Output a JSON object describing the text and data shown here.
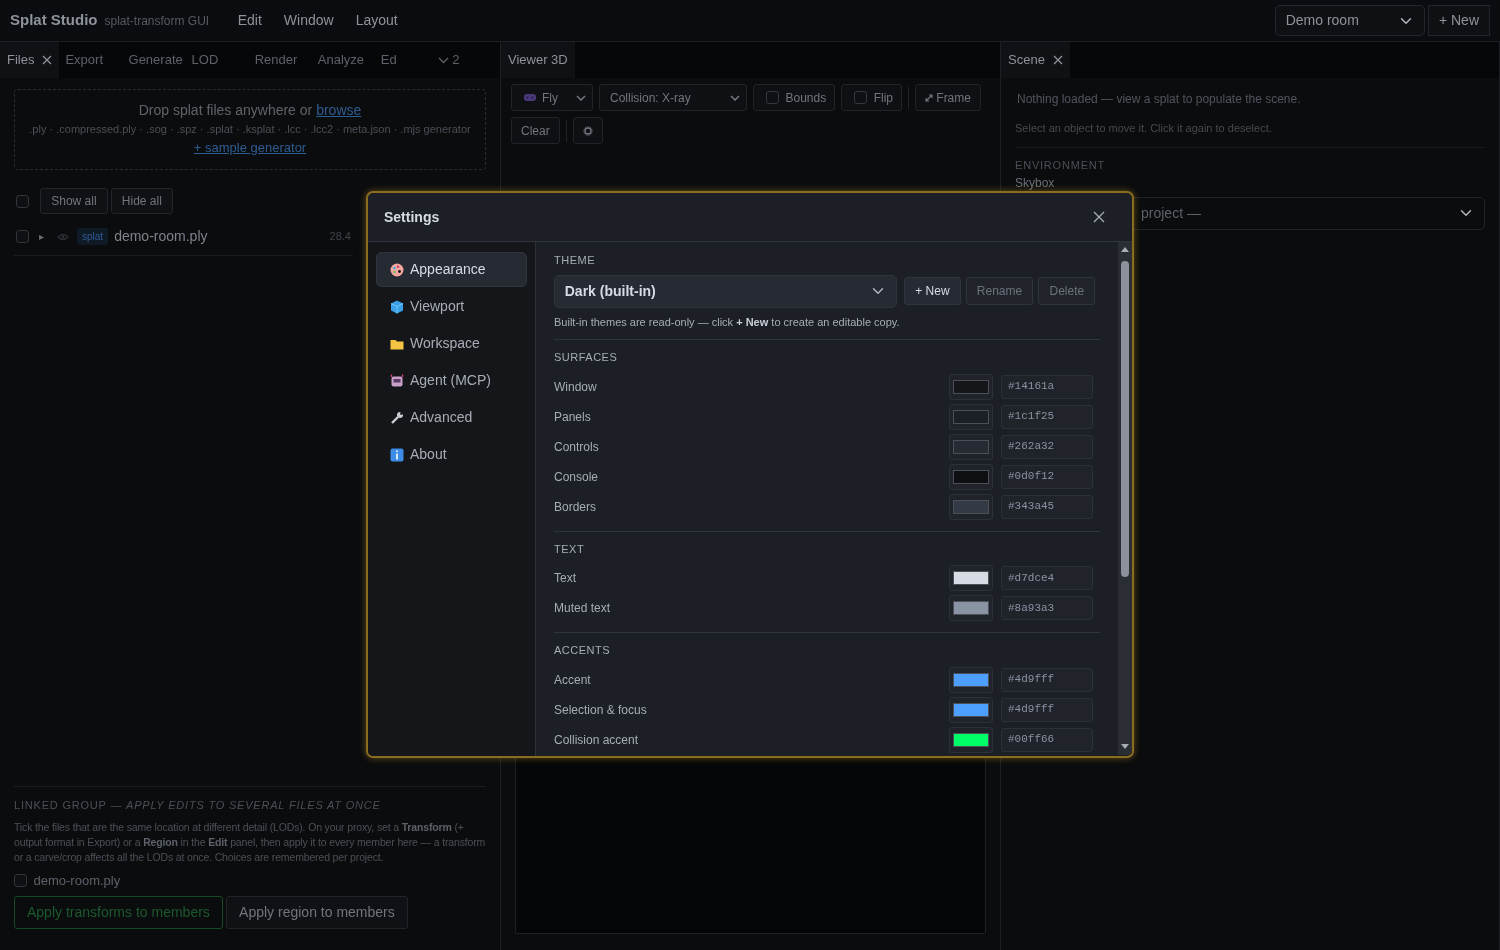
{
  "app_bar": {
    "brand": "Splat Studio",
    "subtitle": "splat-transform GUI",
    "menus": [
      "Edit",
      "Window",
      "Layout"
    ],
    "project_select": "Demo room",
    "new_button": "+ New"
  },
  "left_panel": {
    "tabs": [
      {
        "label": "Files",
        "selected": true,
        "closable": true
      },
      {
        "label": "Export",
        "selected": false
      },
      {
        "label": "Generate",
        "selected": false
      },
      {
        "label": "LOD",
        "selected": false
      },
      {
        "label": "Render",
        "selected": false
      },
      {
        "label": "Analyze",
        "selected": false
      },
      {
        "label": "Ed",
        "selected": false
      }
    ],
    "overflow_count": "2",
    "dropzone": {
      "text": "Drop splat files anywhere or",
      "link": "browse",
      "formats": ".ply · .compressed.ply · .sog · .spz · .splat · .ksplat · .lcc · .lcc2 · meta.json · .mjs generator",
      "sample_link": "+ sample generator"
    },
    "select_all_checked": false,
    "show_all": "Show all",
    "hide_all": "Hide all",
    "files": [
      {
        "checked": false,
        "caret": "▸",
        "tag": "splat",
        "name": "demo-room.ply",
        "size": "28.4"
      }
    ],
    "linked_group": {
      "title": "LINKED GROUP — *APPLY EDITS TO SEVERAL FILES AT ONCE*",
      "description": "Tick the files that are the same location at different detail (LODs). On your proxy, set a **Transform** (+ output format in Export) or a **Region** in the **Edit** panel, then apply it to every member here — a transform or a carve/crop affects all the LODs at once. Choices are remembered per project.",
      "members": [
        {
          "name": "demo-room.ply",
          "checked": false
        }
      ],
      "apply_transforms": "Apply transforms to members",
      "apply_region": "Apply region to members"
    }
  },
  "viewer_panel": {
    "tab": {
      "label": "Viewer 3D",
      "selected": true
    },
    "mode_select": "Fly",
    "collision_select": "Collision: X-ray",
    "toggles": [
      {
        "label": "Bounds",
        "checked": false
      },
      {
        "label": "Flip",
        "checked": false
      }
    ],
    "frame_button": "Frame",
    "clear_button": "Clear"
  },
  "scene_panel": {
    "tab": {
      "label": "Scene",
      "selected": true
    },
    "empty_text": "Nothing loaded — view a splat to populate the scene.",
    "hint": "Select an object to move it. Click it again to deselect.",
    "section": "ENVIRONMENT",
    "skybox_label": "Skybox",
    "skybox_select": "project —"
  },
  "settings_dialog": {
    "title": "Settings",
    "nav": [
      {
        "label": "Appearance",
        "kind": "palette",
        "selected": true
      },
      {
        "label": "Viewport",
        "kind": "cube",
        "selected": false
      },
      {
        "label": "Workspace",
        "kind": "folder",
        "selected": false
      },
      {
        "label": "Agent (MCP)",
        "kind": "robot",
        "selected": false
      },
      {
        "label": "Advanced",
        "kind": "wrench",
        "selected": false
      },
      {
        "label": "About",
        "kind": "info",
        "selected": false
      }
    ],
    "theme": {
      "heading": "THEME",
      "select": "Dark (built-in)",
      "buttons": [
        {
          "label": "+ New",
          "disabled": false
        },
        {
          "label": "Rename",
          "disabled": true
        },
        {
          "label": "Delete",
          "disabled": true
        }
      ],
      "note": "Built-in themes are read-only — click **+ New** to create an editable copy."
    },
    "sections": [
      {
        "heading": "SURFACES",
        "rows": [
          {
            "label": "Window",
            "value": "#14161a",
            "color": "#14161a"
          },
          {
            "label": "Panels",
            "value": "#1c1f25",
            "color": "#1c1f25"
          },
          {
            "label": "Controls",
            "value": "#262a32",
            "color": "#262a32"
          },
          {
            "label": "Console",
            "value": "#0d0f12",
            "color": "#0d0f12"
          },
          {
            "label": "Borders",
            "value": "#343a45",
            "color": "#343a45"
          }
        ]
      },
      {
        "heading": "TEXT",
        "rows": [
          {
            "label": "Text",
            "value": "#d7dce4",
            "color": "#d7dce4"
          },
          {
            "label": "Muted text",
            "value": "#8a93a3",
            "color": "#8a93a3"
          }
        ]
      },
      {
        "heading": "ACCENTS",
        "rows": [
          {
            "label": "Accent",
            "value": "#4d9fff",
            "color": "#4d9fff"
          },
          {
            "label": "Selection & focus",
            "value": "#4d9fff",
            "color": "#4d9fff"
          },
          {
            "label": "Collision accent",
            "value": "#00ff66",
            "color": "#00ff66"
          }
        ]
      }
    ]
  }
}
